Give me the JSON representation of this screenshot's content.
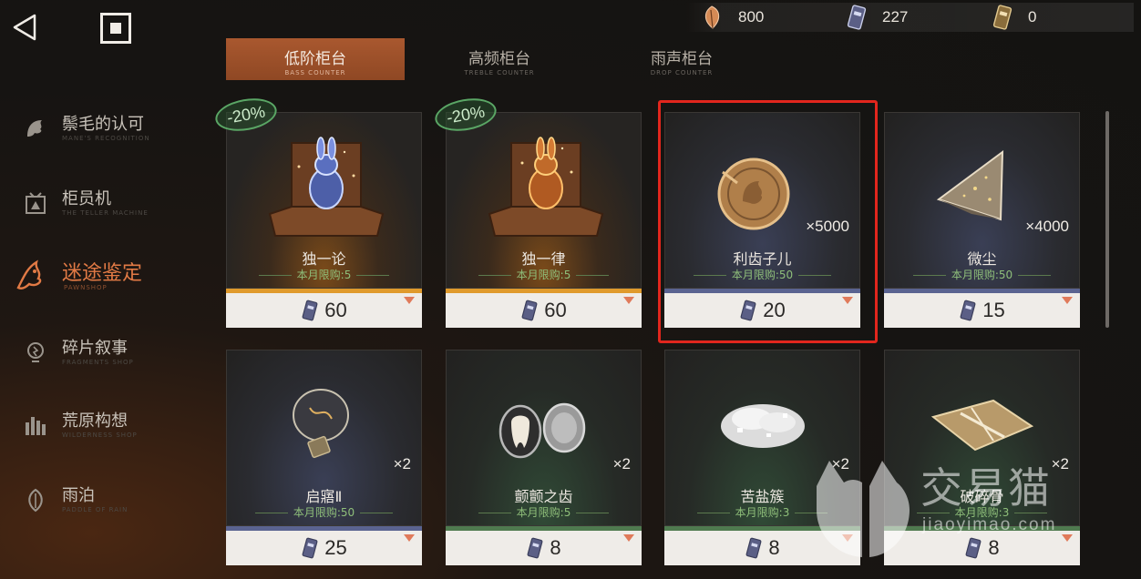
{
  "currencies": [
    {
      "icon": "feather-icon",
      "value": "800"
    },
    {
      "icon": "ticket-icon",
      "value": "227"
    },
    {
      "icon": "gold-ticket-icon",
      "value": "0"
    }
  ],
  "tabs": [
    {
      "label": "低阶柜台",
      "sub": "BASS COUNTER",
      "active": true
    },
    {
      "label": "高频柜台",
      "sub": "TREBLE COUNTER",
      "active": false
    },
    {
      "label": "雨声柜台",
      "sub": "DROP COUNTER",
      "active": false
    }
  ],
  "sidebar": [
    {
      "label": "鬃毛的认可",
      "sub": "MANE'S RECOGNITION",
      "icon": "mane-icon",
      "active": false
    },
    {
      "label": "柜员机",
      "sub": "THE TELLER MACHINE",
      "icon": "teller-machine-icon",
      "active": false
    },
    {
      "label": "迷途鉴定",
      "sub": "PAWNSHOP",
      "icon": "pawnshop-icon",
      "active": true
    },
    {
      "label": "碎片叙事",
      "sub": "FRAGMENTS SHOP",
      "icon": "bulb-icon",
      "active": false
    },
    {
      "label": "荒原构想",
      "sub": "WILDERNESS SHOP",
      "icon": "wilderness-icon",
      "active": false
    },
    {
      "label": "雨泊",
      "sub": "PADDLE OF RAIN",
      "icon": "rain-leaf-icon",
      "active": false
    }
  ],
  "cards": [
    {
      "name": "独一论",
      "limit": "本月限购:5",
      "price": "60",
      "discount": "-20%",
      "qty": "",
      "icon": "glowing-rabbit-chest-icon"
    },
    {
      "name": "独一律",
      "limit": "本月限购:5",
      "price": "60",
      "discount": "-20%",
      "qty": "",
      "icon": "golden-rabbit-chest-icon"
    },
    {
      "name": "利齿子儿",
      "limit": "本月限购:50",
      "price": "20",
      "discount": "",
      "qty": "×5000",
      "icon": "bronze-coin-icon"
    },
    {
      "name": "微尘",
      "limit": "本月限购:50",
      "price": "15",
      "discount": "",
      "qty": "×4000",
      "icon": "crystal-shard-icon"
    },
    {
      "name": "启寤Ⅱ",
      "limit": "本月限购:50",
      "price": "25",
      "discount": "",
      "qty": "×2",
      "icon": "lightbulb-icon"
    },
    {
      "name": "颤颤之齿",
      "limit": "本月限购:5",
      "price": "8",
      "discount": "",
      "qty": "×2",
      "icon": "tooth-locket-icon"
    },
    {
      "name": "苦盐簇",
      "limit": "本月限购:3",
      "price": "8",
      "discount": "",
      "qty": "×2",
      "icon": "salt-cluster-icon"
    },
    {
      "name": "破碎骨",
      "limit": "本月限购:3",
      "price": "8",
      "discount": "",
      "qty": "×2",
      "icon": "broken-bone-icon"
    }
  ],
  "price_currency_icon": "ticket-icon",
  "watermark": {
    "cn": "交易猫",
    "en": "jiaoyimao.com"
  },
  "colors": {
    "accent": "#a9582f",
    "highlight": "#e2261d",
    "limit_green": "#8fbf7a",
    "active_sidebar": "#e27a45"
  }
}
